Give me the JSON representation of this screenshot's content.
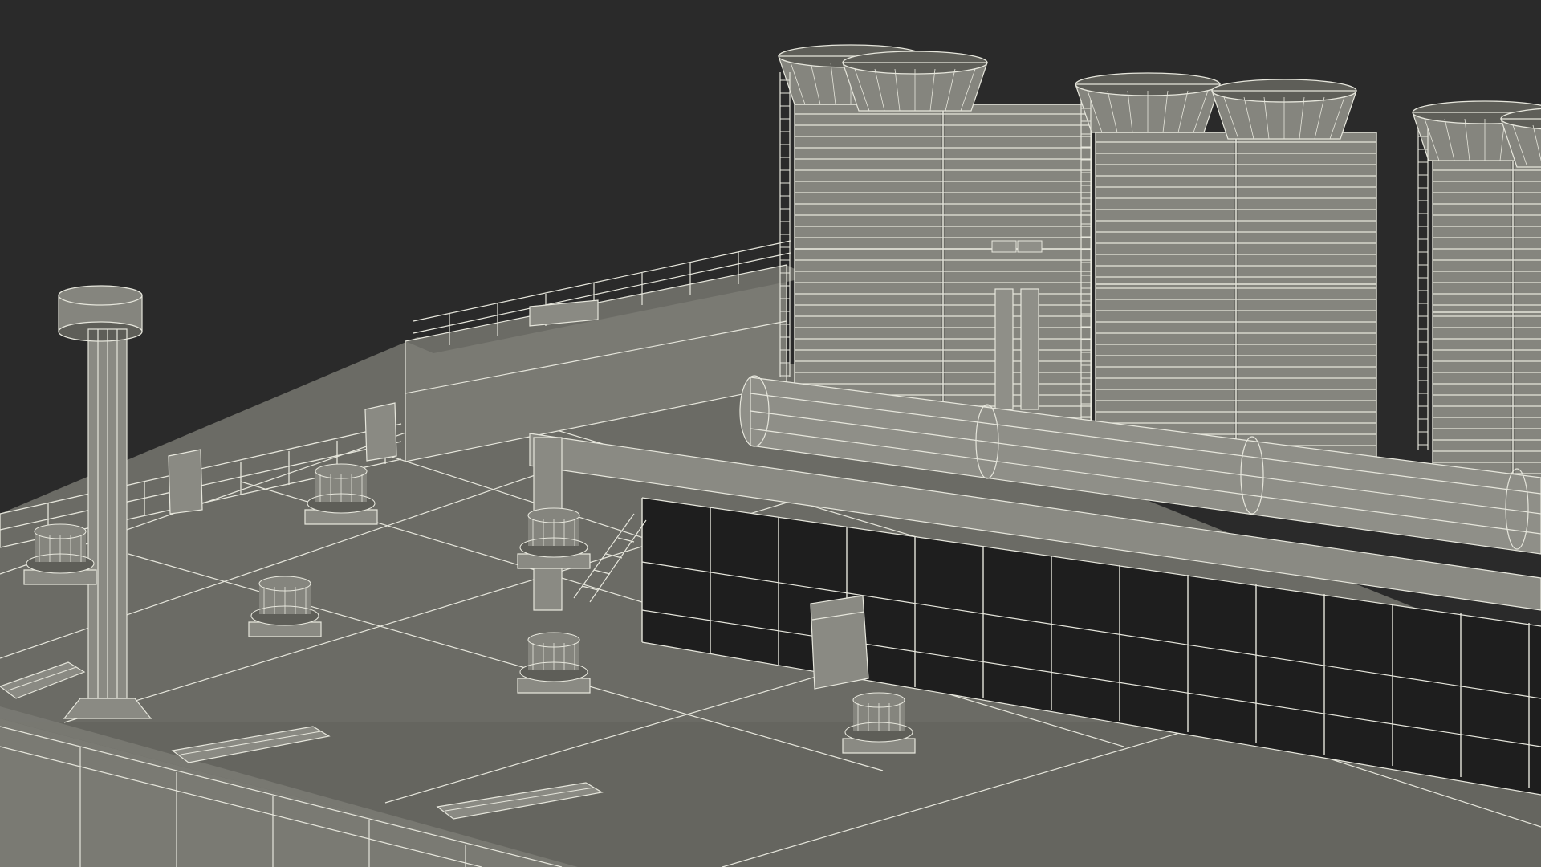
{
  "scene": {
    "subject": "rooftop-hvac-wireframe-render",
    "colors": {
      "background": "#2a2a2a",
      "roof": "#6b6b65",
      "roof_shadow": "#55554f",
      "parapet": "#7a7a73",
      "structure": "#8a8a83",
      "tower": "#85857e",
      "tower_dark": "#5e5e58",
      "pipe": "#8f8f88",
      "gap": "#1e1e1e",
      "wire": "#e6e6dc"
    },
    "counts": {
      "cooling_tower_modules": 3,
      "roof_exhaust_fans": 7,
      "skylight_hatches": 3
    }
  }
}
